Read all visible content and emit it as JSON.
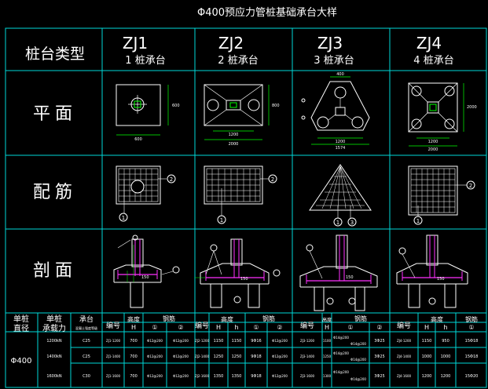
{
  "title": "Φ400预应力管桩基础承台大样",
  "header": {
    "row_label": "桩台类型"
  },
  "types": [
    {
      "code": "ZJ1",
      "desc": "1 桩承台"
    },
    {
      "code": "ZJ2",
      "desc": "2 桩承台"
    },
    {
      "code": "ZJ3",
      "desc": "3 桩承台"
    },
    {
      "code": "ZJ4",
      "desc": "4 桩承台"
    }
  ],
  "rows": {
    "plan": "平面",
    "rebar": "配筋",
    "section": "剖面"
  },
  "callouts": {
    "one": "1",
    "two": "2",
    "three": "3"
  },
  "plan_dims": {
    "zj1_w": "600",
    "zj1_h": "600",
    "zj2_w": "1200",
    "zj2_total": "2000",
    "zj2_h": "800",
    "zj3_top": "400",
    "zj3_w": "1574",
    "zj3_mid": "1200",
    "zj4_w": "1200",
    "zj4_total": "2000",
    "zj4_h": "2000"
  },
  "section_labels": {
    "s1": "150",
    "s2": "150",
    "s3": "150",
    "s4": "150"
  },
  "table": {
    "left_headers": {
      "h1a": "单桩",
      "h1b": "直径",
      "h2a": "单桩",
      "h2b": "承载力",
      "h3a": "承台",
      "h3b": "混凝土强度等级"
    },
    "diameter": "Φ400",
    "rows_left": [
      {
        "cap": "1200kN",
        "conc": "C25"
      },
      {
        "cap": "1400kN",
        "conc": "C25"
      },
      {
        "cap": "1600kN",
        "conc": "C30"
      }
    ],
    "group_headers": {
      "code": "编号",
      "height": "高度",
      "rebar": "钢筋",
      "H": "H",
      "h": "h",
      "r1": "①",
      "r2": "②"
    },
    "zj1": [
      {
        "code": "ZJ1-1200",
        "H": "700",
        "r1": "Φ12@200",
        "r2": "Φ12@200"
      },
      {
        "code": "ZJ1-1400",
        "H": "700",
        "r1": "Φ12@200",
        "r2": "Φ12@200"
      },
      {
        "code": "ZJ1-1600",
        "H": "700",
        "r1": "Φ12@200",
        "r2": "Φ12@200"
      }
    ],
    "zj2": [
      {
        "code": "ZJ2-1200",
        "H": "1150",
        "h": "1150",
        "r1": "9Φ16",
        "r2": "Φ12@200"
      },
      {
        "code": "ZJ2-1400",
        "H": "1250",
        "h": "1250",
        "r1": "9Φ18",
        "r2": "Φ12@200"
      },
      {
        "code": "ZJ2-1600",
        "H": "1350",
        "h": "1350",
        "r1": "9Φ18",
        "r2": "Φ12@200"
      }
    ],
    "zj3": [
      {
        "code": "ZJ3-1200",
        "H": "1100",
        "r1": "Φ14@200",
        "r1b": "Φ14@200",
        "r2": "3Φ25"
      },
      {
        "code": "ZJ3-1400",
        "H": "1250",
        "r1": "Φ14@200",
        "r1b": "Φ14@200",
        "r2": "3Φ25"
      },
      {
        "code": "ZJ3-1600",
        "H": "1300",
        "r1": "Φ14@200",
        "r1b": "Φ14@200",
        "r2": "3Φ25"
      }
    ],
    "zj4": [
      {
        "code": "ZJ4-1200",
        "H": "1150",
        "h": "950",
        "r1": "15Φ18",
        "r2": "15Φ18"
      },
      {
        "code": "ZJ4-1400",
        "H": "1000",
        "h": "1000",
        "r1": "15Φ18",
        "r2": "15Φ18"
      },
      {
        "code": "ZJ4-1600",
        "H": "1200",
        "h": "1200",
        "r1": "15Φ20",
        "r2": "15Φ20"
      }
    ]
  },
  "colors": {
    "bg": "#000000",
    "grid": "#00d8d8",
    "line": "#ffffff",
    "dim": "#00ff00",
    "rebar": "#ff30ff",
    "callout": "#ffff00"
  }
}
